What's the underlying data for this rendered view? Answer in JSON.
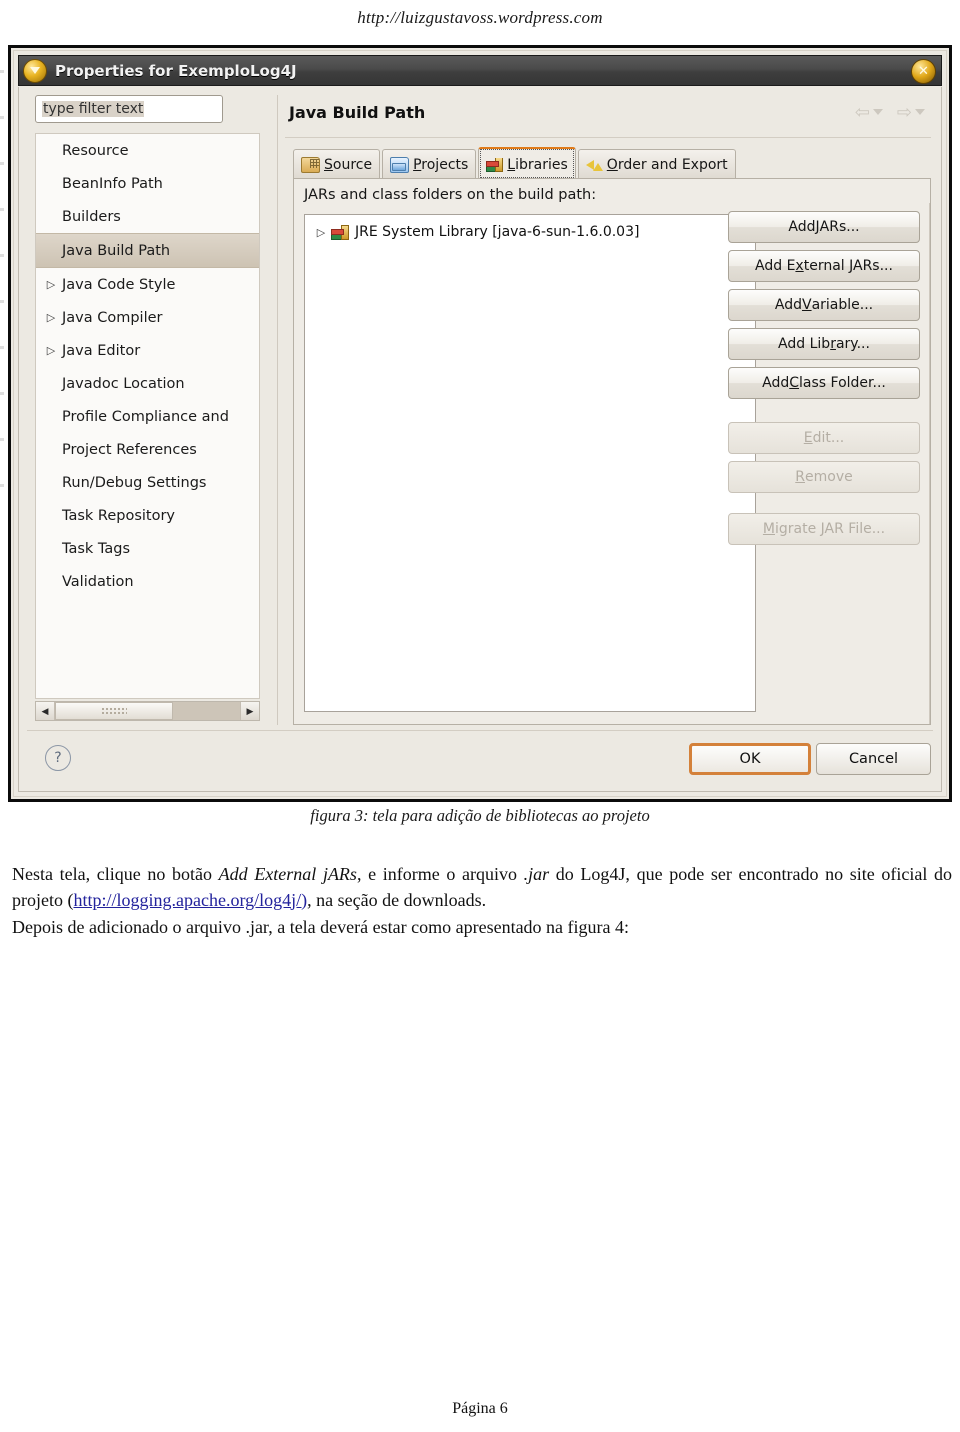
{
  "page": {
    "site_url": "http://luizgustavoss.wordpress.com",
    "footer": "Página 6"
  },
  "dialog": {
    "title": "Properties for ExemploLog4J",
    "close_label": "✕",
    "filter": {
      "value": "type filter text",
      "placeholder": "type filter text"
    },
    "tree_items": [
      {
        "label": "Resource",
        "expandable": false,
        "selected": false
      },
      {
        "label": "BeanInfo Path",
        "expandable": false,
        "selected": false
      },
      {
        "label": "Builders",
        "expandable": false,
        "selected": false
      },
      {
        "label": "Java Build Path",
        "expandable": false,
        "selected": true
      },
      {
        "label": "Java Code Style",
        "expandable": true,
        "selected": false
      },
      {
        "label": "Java Compiler",
        "expandable": true,
        "selected": false
      },
      {
        "label": "Java Editor",
        "expandable": true,
        "selected": false
      },
      {
        "label": "Javadoc Location",
        "expandable": false,
        "selected": false
      },
      {
        "label": "Profile Compliance and",
        "expandable": false,
        "selected": false
      },
      {
        "label": "Project References",
        "expandable": false,
        "selected": false
      },
      {
        "label": "Run/Debug Settings",
        "expandable": false,
        "selected": false
      },
      {
        "label": "Task Repository",
        "expandable": false,
        "selected": false
      },
      {
        "label": "Task Tags",
        "expandable": false,
        "selected": false
      },
      {
        "label": "Validation",
        "expandable": false,
        "selected": false
      }
    ],
    "page_title": "Java Build Path",
    "nav": {
      "back": "back-arrow",
      "forward": "forward-arrow"
    },
    "tabs": [
      {
        "label": "Source",
        "icon": "source-folder-icon",
        "active": false,
        "mnemonic": "S"
      },
      {
        "label": "Projects",
        "icon": "projects-folder-icon",
        "active": false,
        "mnemonic": "P"
      },
      {
        "label": "Libraries",
        "icon": "books-icon",
        "active": true,
        "mnemonic": "L"
      },
      {
        "label": "Order and Export",
        "icon": "order-arrows-icon",
        "active": false,
        "mnemonic": "O"
      }
    ],
    "list_label": "JARs and class folders on the build path:",
    "list_items": [
      {
        "label": "JRE System Library [java-6-sun-1.6.0.03]",
        "icon": "jre-library-icon",
        "expandable": true
      }
    ],
    "buttons": [
      {
        "label": "Add JARs...",
        "mnemonic": "J",
        "disabled": false
      },
      {
        "label": "Add External JARs...",
        "mnemonic": "x",
        "disabled": false
      },
      {
        "label": "Add Variable...",
        "mnemonic": "V",
        "disabled": false
      },
      {
        "label": "Add Library...",
        "mnemonic": "r",
        "disabled": false
      },
      {
        "label": "Add Class Folder...",
        "mnemonic": "C",
        "disabled": false
      },
      {
        "label": "Edit...",
        "mnemonic": "E",
        "disabled": true
      },
      {
        "label": "Remove",
        "mnemonic": "R",
        "disabled": true
      },
      {
        "label": "Migrate JAR File...",
        "mnemonic": "M",
        "disabled": true
      }
    ],
    "help_glyph": "?",
    "ok_label": "OK",
    "cancel_label": "Cancel",
    "accent_color": "#e07b1a"
  },
  "caption": "figura 3: tela para adição de bibliotecas ao projeto",
  "body": {
    "p1_a": "Nesta tela, clique no botão ",
    "p1_em": "Add External jARs",
    "p1_b": ", e informe o arquivo ",
    "p1_em2": ".jar",
    "p1_c": " do Log4J, que pode ser encontrado no site oficial do projeto (",
    "p1_link": "http://logging.apache.org/log4j/)",
    "p1_d": ", na seção de downloads.",
    "p2": "Depois de adicionado o arquivo .jar, a tela deverá estar como apresentado na figura 4:"
  }
}
